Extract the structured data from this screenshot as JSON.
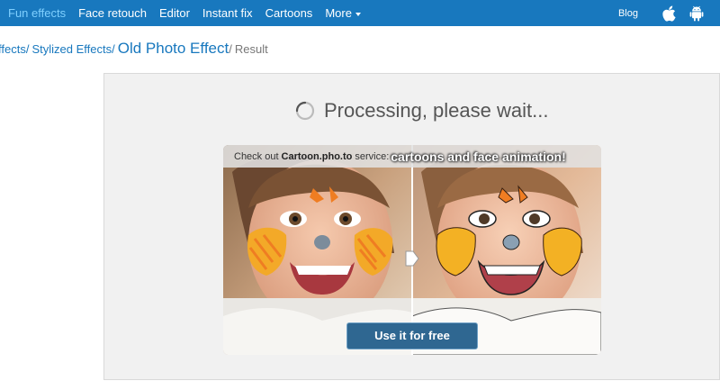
{
  "nav": {
    "items": [
      {
        "label": "Fun effects",
        "active": true
      },
      {
        "label": "Face retouch"
      },
      {
        "label": "Editor"
      },
      {
        "label": "Instant fix"
      },
      {
        "label": "Cartoons"
      },
      {
        "label": "More"
      }
    ],
    "blog_label": "Blog",
    "icons": [
      "apple-icon",
      "android-icon"
    ],
    "accent_color": "#1878be",
    "active_color": "#7fd0ff"
  },
  "breadcrumb": {
    "items": [
      "Effects",
      "Stylized Effects"
    ],
    "visible_first": "ffects",
    "separator": "/",
    "current": "Old Photo Effect",
    "result": "Result"
  },
  "status": {
    "text": "Processing, please wait...",
    "icon": "spinner-icon"
  },
  "promo": {
    "caption_prefix": "Check out",
    "caption_brand": "Cartoon.pho.to",
    "caption_suffix": "service:",
    "caption_highlight": "cartoons and face animation!",
    "button_label": "Use it for free",
    "button_color": "#2f6791"
  }
}
